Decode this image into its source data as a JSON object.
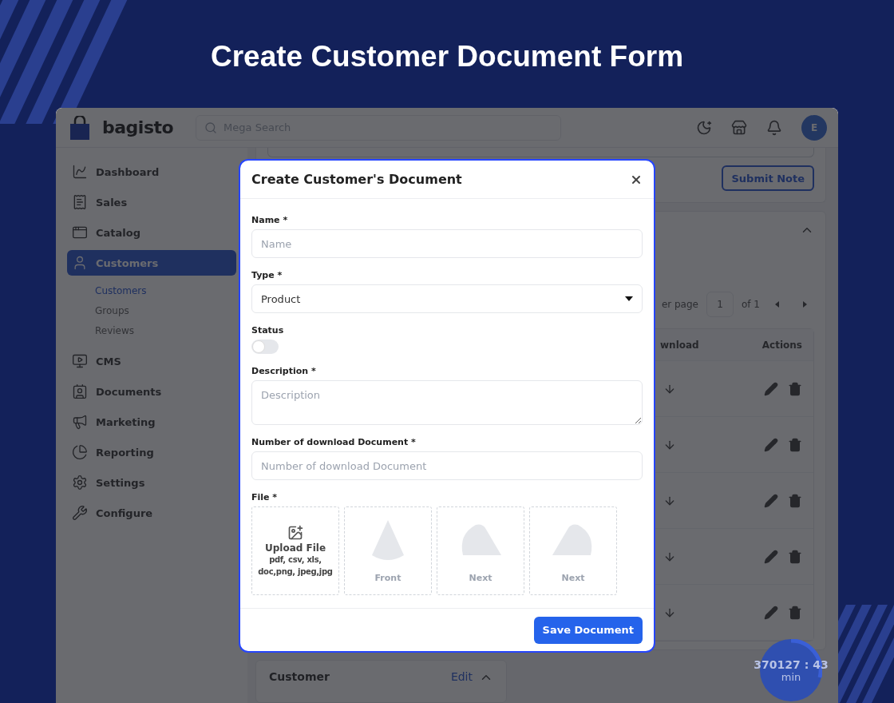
{
  "page_title": "Create Customer Document Form",
  "app": {
    "logo": "bagisto",
    "search": {
      "placeholder": "Mega Search"
    },
    "avatar": "E",
    "sidebar": [
      {
        "label": "Dashboard",
        "selected": false
      },
      {
        "label": "Sales",
        "selected": false
      },
      {
        "label": "Catalog",
        "selected": false
      },
      {
        "label": "Customers",
        "selected": true,
        "children": [
          {
            "label": "Customers",
            "selected": true
          },
          {
            "label": "Groups",
            "selected": false
          },
          {
            "label": "Reviews",
            "selected": false
          }
        ]
      },
      {
        "label": "CMS",
        "selected": false
      },
      {
        "label": "Documents",
        "selected": false
      },
      {
        "label": "Marketing",
        "selected": false
      },
      {
        "label": "Reporting",
        "selected": false
      },
      {
        "label": "Settings",
        "selected": false
      },
      {
        "label": "Configure",
        "selected": false
      }
    ],
    "notes": {
      "button": "Submit Note"
    },
    "pagination": {
      "per_page_label": "er page",
      "page": "1",
      "total": "of 1"
    },
    "table": {
      "columns": [
        "wnload",
        "Actions"
      ],
      "rows": [
        {
          "kind": "document"
        },
        {
          "kind": "document"
        },
        {
          "kind": "document"
        },
        {
          "kind": "document"
        },
        {
          "kind": "document"
        }
      ]
    },
    "customer_card": {
      "title": "Customer",
      "link": "Edit"
    },
    "timer": {
      "value": "370127 : 43",
      "unit": "min"
    }
  },
  "modal": {
    "title": "Create Customer's Document",
    "fields": [
      {
        "kind": "text",
        "label": "Name *",
        "placeholder": "Name"
      },
      {
        "kind": "select",
        "label": "Type *",
        "value": "Product"
      },
      {
        "kind": "toggle",
        "label": "Status",
        "on": false
      },
      {
        "kind": "textarea",
        "label": "Description *",
        "placeholder": "Description"
      },
      {
        "kind": "text",
        "label": "Number of download Document *",
        "placeholder": "Number of download Document"
      },
      {
        "kind": "file",
        "label": "File *",
        "upload": {
          "title": "Upload File",
          "formats": "pdf, csv, xls, doc,png, jpeg,jpg"
        },
        "slots": [
          "Front",
          "Next",
          "Next"
        ]
      }
    ],
    "submit": "Save Document"
  }
}
